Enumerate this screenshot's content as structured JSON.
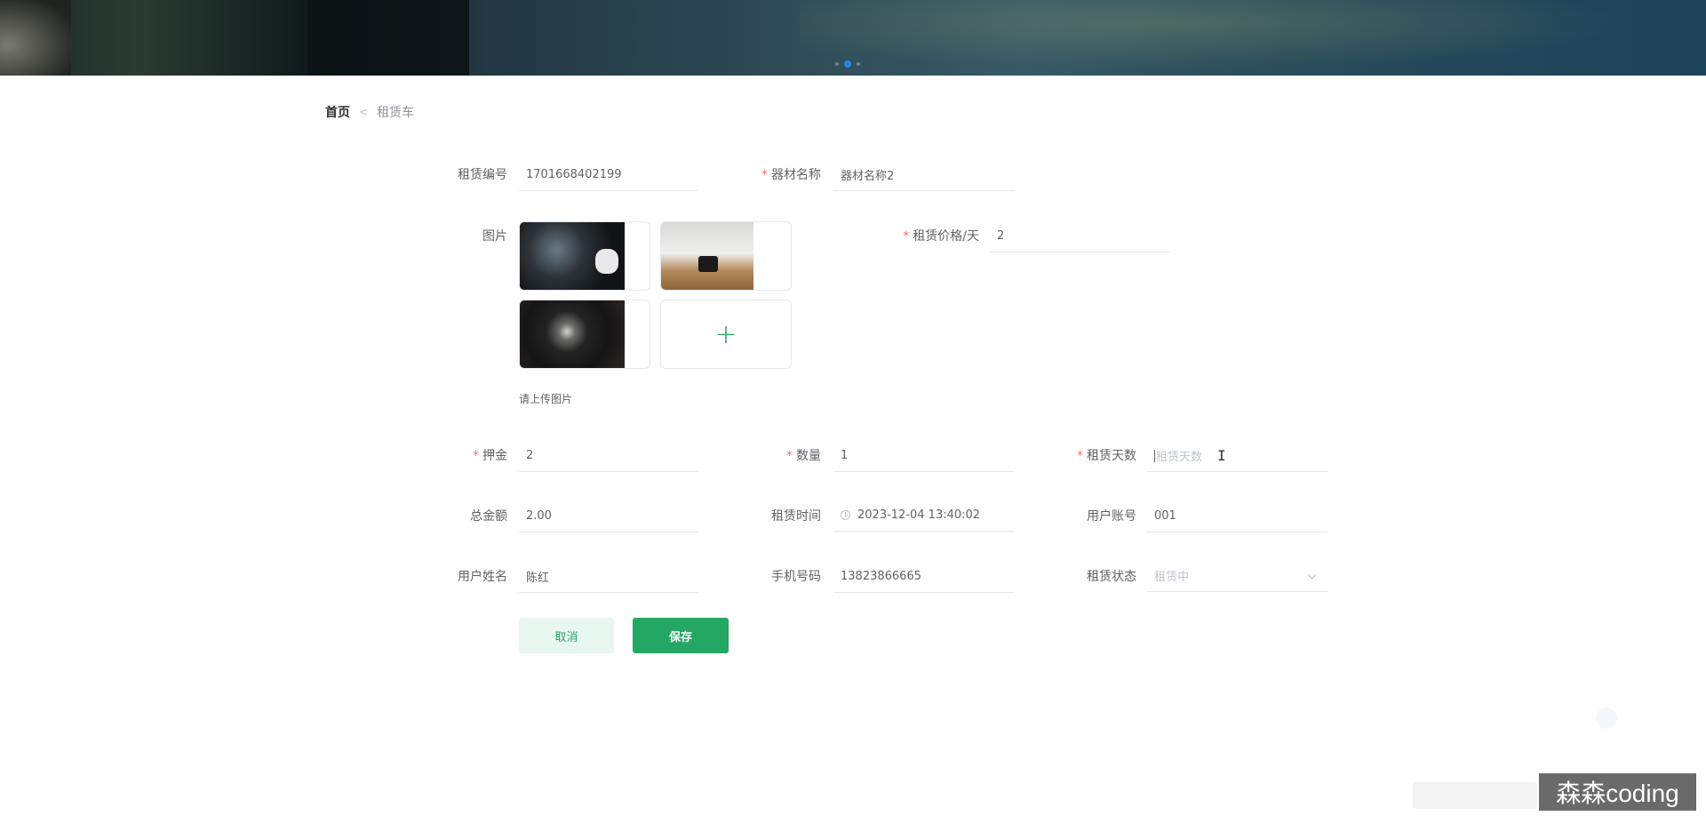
{
  "banner": {
    "carousel_dots": 3,
    "active_dot": 1
  },
  "breadcrumb": {
    "home": "首页",
    "separator": "<",
    "current": "租赁车"
  },
  "form": {
    "rental_no": {
      "label": "租赁编号",
      "value": "1701668402199"
    },
    "equipment_name": {
      "label": "器材名称",
      "value": "器材名称2",
      "required": true
    },
    "images": {
      "label": "图片",
      "tip": "请上传图片",
      "count": 3,
      "upload_icon": "plus-icon"
    },
    "price_per_day": {
      "label": "租赁价格/天",
      "value": "2",
      "required": true
    },
    "deposit": {
      "label": "押金",
      "value": "2",
      "required": true
    },
    "quantity": {
      "label": "数量",
      "value": "1",
      "required": true
    },
    "rental_days": {
      "label": "租赁天数",
      "value": "",
      "placeholder": "租赁天数",
      "required": true
    },
    "total_amount": {
      "label": "总金额",
      "value": "2.00"
    },
    "rental_time": {
      "label": "租赁时间",
      "value": "2023-12-04 13:40:02",
      "icon": "clock-icon"
    },
    "user_account": {
      "label": "用户账号",
      "value": "001"
    },
    "user_name": {
      "label": "用户姓名",
      "value": "陈红"
    },
    "phone": {
      "label": "手机号码",
      "value": "13823866665"
    },
    "rental_status": {
      "label": "租赁状态",
      "value": "租赁中",
      "icon": "chevron-down-icon"
    }
  },
  "buttons": {
    "cancel": "取消",
    "save": "保存"
  },
  "watermark": "森森coding",
  "colors": {
    "primary": "#25a764",
    "primary_light": "#e8f7ef",
    "required": "#f56c6c",
    "active_dot": "#1e88e5"
  }
}
